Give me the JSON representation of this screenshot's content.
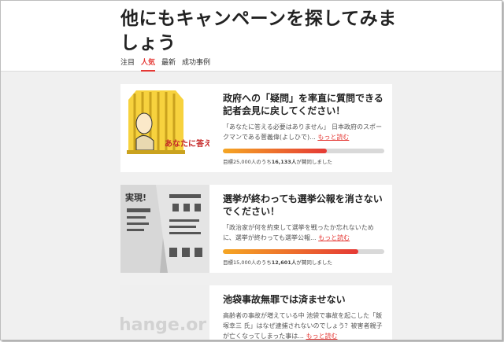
{
  "page": {
    "title": "他にもキャンペーンを探してみましょう",
    "accent_color": "#e53935"
  },
  "tabs": [
    {
      "label": "注目",
      "active": false
    },
    {
      "label": "人気",
      "active": true
    },
    {
      "label": "最新",
      "active": false
    },
    {
      "label": "成功事例",
      "active": false
    }
  ],
  "campaigns": [
    {
      "title": "政府への「疑問」を率直に質問できる記者会見に戻してください！",
      "description": "「あなたに答える必要はありません」 日本政府のスポークマンである菅義偉(よしひで)...",
      "more_label": "もっと読む",
      "thumbnail_text": "あなたに答え 必要はあり",
      "goal_prefix": "目標25,000人のうち",
      "supporters": "16,133人",
      "goal_suffix": "が賛同しました",
      "progress": 0.6453
    },
    {
      "title": "選挙が終わっても選挙公報を消さないでください！",
      "description": "「政治家が何を約束して選挙を戦ったか忘れないために、選挙が終わっても選挙公報...",
      "more_label": "もっと読む",
      "goal_prefix": "目標15,000人のうち",
      "supporters": "12,601人",
      "goal_suffix": "が賛同しました",
      "progress": 0.84
    },
    {
      "title": "池袋事故無罪では済ませない",
      "description": "高齢者の事故が増えている中 池袋で事故を起こした「飯塚幸三 氏」はなぜ逮捕されないのでしょう？被害者親子が亡くなってしまった事は...",
      "more_label": "もっと読む",
      "thumbnail_text": "hange.or"
    }
  ]
}
